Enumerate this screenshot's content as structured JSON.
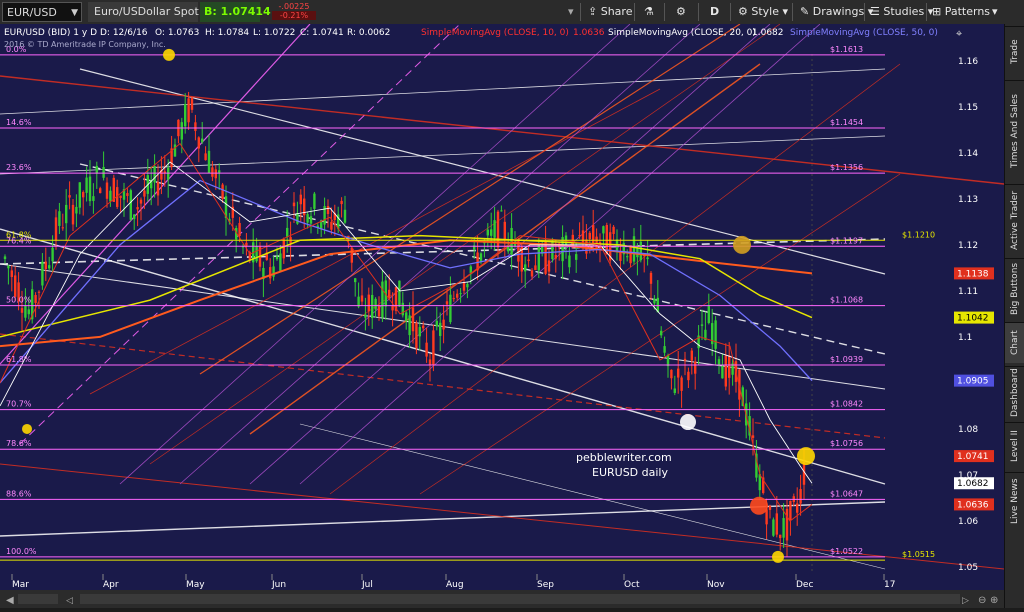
{
  "toolbar": {
    "symbol": "EUR/USD",
    "description": "Euro/USDollar Spot",
    "bid": "B: 1.07414",
    "change": "-.00225",
    "change_pct": "-0.21%",
    "share": "Share",
    "period": "D",
    "style": "Style",
    "drawings": "Drawings",
    "studies": "Studies",
    "patterns": "Patterns"
  },
  "header": {
    "title": "EUR/USD (BID) 1 y D",
    "date": "D: 12/6/16",
    "open": "O: 1.0763",
    "high": "H: 1.0784",
    "low": "L: 1.0722",
    "close": "C: 1.0741",
    "range": "R: 0.0062",
    "copyright": "2016 © TD Ameritrade IP Company, Inc.",
    "sma10": "SimpleMovingAvg (CLOSE, 10, 0)",
    "sma10_val": "1.0636",
    "sma20": "SimpleMovingAvg (CLOSE, 20, 0)",
    "sma20_val": "1.0682",
    "sma50": "SimpleMovingAvg (CLOSE, 50, 0)",
    "sma50_val": "1.1042"
  },
  "annotation": {
    "site": "pebblewriter.com",
    "label": "EURUSD daily"
  },
  "sidebar": {
    "tabs": [
      "Trade",
      "Times And Sales",
      "Active Trader",
      "Big Buttons",
      "Chart",
      "Dashboard",
      "Level II",
      "Live News"
    ]
  },
  "chart_data": {
    "type": "candlestick",
    "symbol": "EUR/USD",
    "ylim": [
      1.045,
      1.168
    ],
    "y_ticks": [
      1.05,
      1.06,
      1.07,
      1.08,
      1.09,
      1.1,
      1.11,
      1.12,
      1.13,
      1.14,
      1.15,
      1.16
    ],
    "x_ticks": [
      "Mar",
      "Apr",
      "May",
      "Jun",
      "Jul",
      "Aug",
      "Sep",
      "Oct",
      "Nov",
      "Dec",
      "17"
    ],
    "fib_levels": [
      {
        "pct": "0.0%",
        "value": "$1.1613",
        "y": 1.1613
      },
      {
        "pct": "14.6%",
        "value": "$1.1454",
        "y": 1.1454
      },
      {
        "pct": "23.6%",
        "value": "$1.1356",
        "y": 1.1356
      },
      {
        "pct": "61.8%",
        "value": "$1.1210",
        "y": 1.121
      },
      {
        "pct": "76.4%",
        "value": "$1.1197",
        "y": 1.1197
      },
      {
        "pct": "50.0%",
        "value": "$1.1068",
        "y": 1.1068
      },
      {
        "pct": "61.8%",
        "value": "$1.0939",
        "y": 1.0939
      },
      {
        "pct": "70.7%",
        "value": "$1.0842",
        "y": 1.0842
      },
      {
        "pct": "78.6%",
        "value": "$1.0756",
        "y": 1.0756
      },
      {
        "pct": "88.6%",
        "value": "$1.0647",
        "y": 1.0647
      },
      {
        "pct": "100.0%",
        "value": "$1.0522",
        "y": 1.0522
      },
      {
        "pct": "",
        "value": "$1.0515",
        "y": 1.0515
      }
    ],
    "price_tags": [
      {
        "value": "1.1138",
        "y": 1.1138,
        "color": "#e0301e"
      },
      {
        "value": "1.1042",
        "y": 1.1042,
        "color": "#e6e600"
      },
      {
        "value": "1.0905",
        "y": 1.0905,
        "color": "#5050e0"
      },
      {
        "value": "1.0741",
        "y": 1.0741,
        "color": "#e0301e"
      },
      {
        "value": "1.0682",
        "y": 1.0682,
        "color": "#ffffff"
      },
      {
        "value": "1.0636",
        "y": 1.0636,
        "color": "#e0301e"
      }
    ],
    "series": [
      {
        "name": "SimpleMovingAvg (CLOSE, 10, 0)",
        "color": "#e0301e"
      },
      {
        "name": "SimpleMovingAvg (CLOSE, 20, 0)",
        "color": "#ffffff"
      },
      {
        "name": "SimpleMovingAvg (CLOSE, 50, 0)",
        "color": "#8080ff"
      }
    ]
  }
}
